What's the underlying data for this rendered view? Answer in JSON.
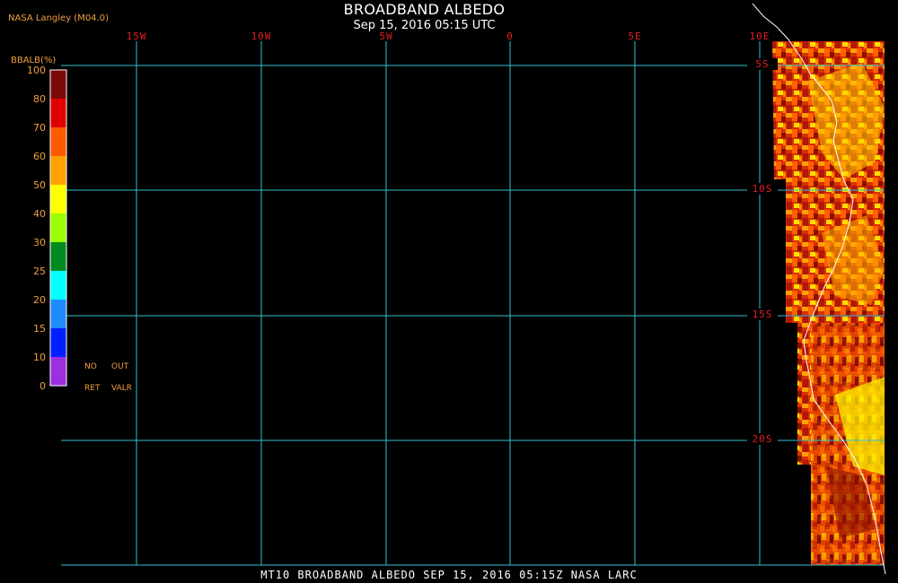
{
  "header": {
    "title": "BROADBAND ALBEDO",
    "subtitle": "Sep 15, 2016 05:15 UTC",
    "credit": "NASA Langley (M04.0)"
  },
  "legend": {
    "title": "BBALB(%)",
    "ticks": [
      "100",
      "80",
      "70",
      "60",
      "50",
      "40",
      "30",
      "25",
      "20",
      "15",
      "10",
      "0"
    ],
    "colors": [
      "#7a0a0a",
      "#e00000",
      "#ff5a00",
      "#ffa000",
      "#ffff00",
      "#9aff00",
      "#008a20",
      "#00ffff",
      "#1e8cff",
      "#0020ff",
      "#9a30e0"
    ],
    "no_ret": [
      "NO",
      "RET"
    ],
    "out_valr": [
      "OUT",
      "VALR"
    ]
  },
  "longitude_labels": [
    "15W",
    "10W",
    "5W",
    "0",
    "5E",
    "10E"
  ],
  "latitude_labels": [
    "5S",
    "10S",
    "15S",
    "20S"
  ],
  "footer": "MT10  BROADBAND ALBEDO  SEP 15, 2016 05:15Z  NASA LARC",
  "colors": {
    "grid": "#30c0d0",
    "label": "#e02020",
    "legend_text": "#f0a040",
    "coastline": "#ffffff"
  }
}
